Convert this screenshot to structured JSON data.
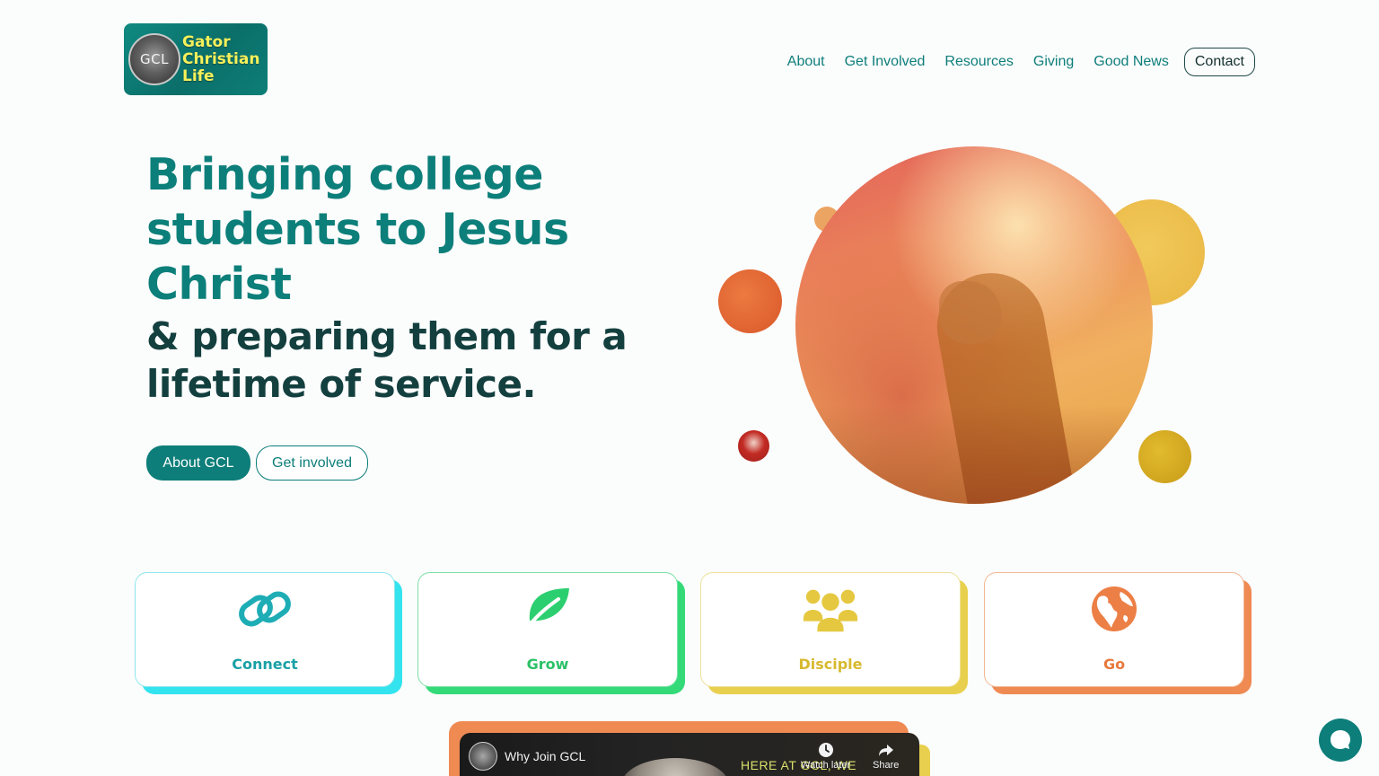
{
  "logo": {
    "emblem_text": "GCL",
    "lines": [
      "Gator",
      "Christian",
      "Life"
    ]
  },
  "nav": {
    "items": [
      "About",
      "Get Involved",
      "Resources",
      "Giving",
      "Good News"
    ],
    "contact_label": "Contact"
  },
  "hero": {
    "title": "Bringing college students to Jesus Christ",
    "subtitle": "& preparing them for a lifetime of service.",
    "primary_button": "About GCL",
    "secondary_button": "Get involved"
  },
  "cards": [
    {
      "label": "Connect",
      "icon": "link-icon",
      "color": "#1ec9cf",
      "shadow": "#33e3ee"
    },
    {
      "label": "Grow",
      "icon": "leaf-icon",
      "color": "#2ccf6f",
      "shadow": "#34da78"
    },
    {
      "label": "Disciple",
      "icon": "users-icon",
      "color": "#e2c43c",
      "shadow": "#e8d04e"
    },
    {
      "label": "Go",
      "icon": "globe-icon",
      "color": "#ec8a52",
      "shadow": "#ee8a52"
    }
  ],
  "video": {
    "title": "Why Join GCL",
    "caption": "HERE AT GCL, WE",
    "watch_later": "Watch later",
    "share": "Share"
  },
  "colors": {
    "primary": "#0d7e7a",
    "heading_dark": "#13403f"
  }
}
